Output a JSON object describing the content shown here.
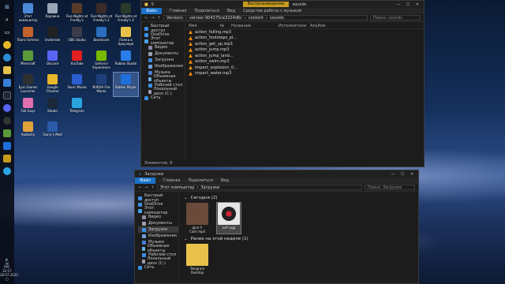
{
  "taskbar": {
    "lang": "РУС",
    "time": "22:17",
    "date": "28.07.2022"
  },
  "desktop": {
    "icons": [
      {
        "label": "Этот компьютер",
        "color": "#4a8ad8"
      },
      {
        "label": "Корзина",
        "color": "#9aa7b8"
      },
      {
        "label": "Five Nights at Freddy's",
        "color": "#5a3b2a"
      },
      {
        "label": "Five Nights at Freddy's 2",
        "color": "#3a2a2a"
      },
      {
        "label": "Five Nights at Freddy's 3",
        "color": "#2a3a2a"
      },
      {
        "label": "Team Fortress",
        "color": "#c2622c"
      },
      {
        "label": "Undertale",
        "color": "#222"
      },
      {
        "label": "OBS Studio",
        "color": "#3b3b4a"
      },
      {
        "label": "Bandicam",
        "color": "#2b6dbe"
      },
      {
        "label": "Папка в Браузере",
        "color": "#e8c14a"
      },
      {
        "label": "Minecraft",
        "color": "#5a9a3a"
      },
      {
        "label": "Discord",
        "color": "#5865f2"
      },
      {
        "label": "YouTube",
        "color": "#e02020"
      },
      {
        "label": "GeForce Experience",
        "color": "#76b900"
      },
      {
        "label": "Roblox Studio",
        "color": "#2b7de9"
      },
      {
        "label": "Epic Games Launcher",
        "color": "#303030"
      },
      {
        "label": "Google Chrome",
        "color": "#e8b82a"
      },
      {
        "label": "Sonic Mania",
        "color": "#2a5fd0"
      },
      {
        "label": "NVIDIA Fire Mania",
        "color": "#1f3f7a"
      },
      {
        "label": "Roblox Player",
        "color": "#1e6fd9"
      },
      {
        "label": "Fall Guys",
        "color": "#e070b0"
      },
      {
        "label": "Steam",
        "color": "#1b2838"
      },
      {
        "label": "Telegram",
        "color": "#2aa3df"
      },
      {
        "label": "",
        "color": "transparent"
      },
      {
        "label": "",
        "color": "transparent"
      },
      {
        "label": "Audacity",
        "color": "#e0a23a"
      },
      {
        "label": "Garry's Mod",
        "color": "#2a5ba8"
      }
    ]
  },
  "win_top": {
    "title": "5",
    "context_tab": "Воспроизведение",
    "context_title": "sounds",
    "ribbon_file": "Файл",
    "ribbon_tabs": [
      "Главная",
      "Поделиться",
      "Вид",
      "Средства работы с музыкой"
    ],
    "path": [
      "Versions",
      "version-904375ce3224d6c",
      "content",
      "sounds"
    ],
    "search_placeholder": "Поиск: sounds",
    "sidebar": [
      {
        "label": "Быстрый доступ",
        "icon": "star-icon",
        "color": "#3a8ee6",
        "indent": false
      },
      {
        "label": "OneDrive",
        "icon": "cloud-icon",
        "color": "#3a8ee6",
        "indent": false
      },
      {
        "label": "Этот компьютер",
        "icon": "computer-icon",
        "color": "#4aa0e6",
        "indent": false
      },
      {
        "label": "Видео",
        "icon": "video-icon",
        "color": "#8a8aa8",
        "indent": true
      },
      {
        "label": "Документы",
        "icon": "document-icon",
        "color": "#9aa0b0",
        "indent": true
      },
      {
        "label": "Загрузки",
        "icon": "download-icon",
        "color": "#3a8ee6",
        "indent": true
      },
      {
        "label": "Изображения",
        "icon": "image-icon",
        "color": "#6aa0d8",
        "indent": true
      },
      {
        "label": "Музыка",
        "icon": "music-icon",
        "color": "#4a7fd8",
        "indent": true
      },
      {
        "label": "Объемные объекты",
        "icon": "cube-icon",
        "color": "#6ab0e6",
        "indent": true
      },
      {
        "label": "Рабочий стол",
        "icon": "desktop-icon",
        "color": "#3a8ee6",
        "indent": true
      },
      {
        "label": "Локальный диск (C:)",
        "icon": "drive-icon",
        "color": "#9aa0b0",
        "indent": true
      },
      {
        "label": "Сеть",
        "icon": "network-icon",
        "color": "#3a8ee6",
        "indent": false
      }
    ],
    "columns": [
      "Имя",
      "№",
      "Название",
      "Исполнители",
      "Альбом"
    ],
    "files": [
      "action_falling.mp3",
      "action_footsteps_pl...",
      "action_get_up.mp3",
      "action_jump.mp3",
      "action_jump_land...",
      "action_swim.mp3",
      "impact_explosion_0...",
      "impact_water.mp3"
    ],
    "status": "Элементов: 8"
  },
  "win_bottom": {
    "title": "Загрузки",
    "ribbon_file": "Файл",
    "ribbon_tabs": [
      "Главная",
      "Поделиться",
      "Вид"
    ],
    "path": [
      "Этот компьютер",
      "Загрузки"
    ],
    "search_placeholder": "Поиск: Загрузки",
    "sidebar": [
      {
        "label": "Быстрый доступ",
        "icon": "star-icon",
        "color": "#3a8ee6",
        "indent": false
      },
      {
        "label": "OneDrive",
        "icon": "cloud-icon",
        "color": "#3a8ee6",
        "indent": false
      },
      {
        "label": "Этот компьютер",
        "icon": "computer-icon",
        "color": "#4aa0e6",
        "indent": false
      },
      {
        "label": "Видео",
        "icon": "video-icon",
        "color": "#8a8aa8",
        "indent": true
      },
      {
        "label": "Документы",
        "icon": "document-icon",
        "color": "#9aa0b0",
        "indent": true
      },
      {
        "label": "Загрузки",
        "icon": "download-icon",
        "color": "#3a8ee6",
        "indent": true,
        "selected": true
      },
      {
        "label": "Изображения",
        "icon": "image-icon",
        "color": "#6aa0d8",
        "indent": true
      },
      {
        "label": "Музыка",
        "icon": "music-icon",
        "color": "#4a7fd8",
        "indent": true
      },
      {
        "label": "Объемные объекты",
        "icon": "cube-icon",
        "color": "#6ab0e6",
        "indent": true
      },
      {
        "label": "Рабочий стол",
        "icon": "desktop-icon",
        "color": "#3a8ee6",
        "indent": true
      },
      {
        "label": "Локальный диск (C:)",
        "icon": "drive-icon",
        "color": "#9aa0b0",
        "indent": true
      },
      {
        "label": "Сеть",
        "icon": "network-icon",
        "color": "#3a8ee6",
        "indent": false
      }
    ],
    "group_today": "Сегодня (2)",
    "group_week": "Ранее на этой неделе (1)",
    "today_files": [
      {
        "label": "glue fr Cash.mp4",
        "color": "#6a4a3a",
        "selected": false
      },
      {
        "label": "oof².ogg",
        "color": "#d8d8d8",
        "selected": true
      }
    ],
    "week_files": [
      {
        "label": "Telegram Desktop",
        "color": "#e8c14a",
        "selected": false
      }
    ]
  }
}
